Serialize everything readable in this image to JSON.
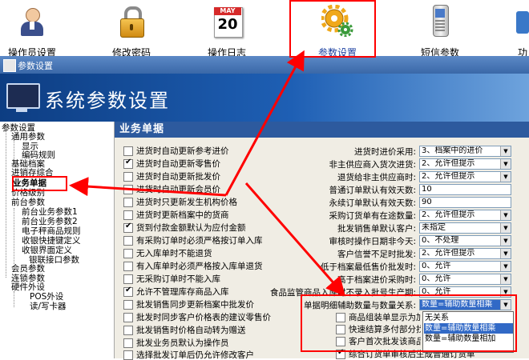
{
  "toolbar": {
    "items": [
      {
        "label": "操作员设置",
        "icon": "operators-icon"
      },
      {
        "label": "修改密码",
        "icon": "lock-icon"
      },
      {
        "label": "操作日志",
        "icon": "calendar-icon"
      },
      {
        "label": "参数设置",
        "icon": "gear-icon"
      },
      {
        "label": "短信参数",
        "icon": "phone-icon"
      },
      {
        "label": "功",
        "icon": "partial-icon"
      }
    ],
    "calendar_month": "MAY",
    "calendar_day": "20"
  },
  "window": {
    "title": "参数设置"
  },
  "banner": {
    "title": "系统参数设置"
  },
  "tree": {
    "nodes": [
      {
        "label": "参数设置"
      },
      {
        "label": "通用参数"
      },
      {
        "label": "显示"
      },
      {
        "label": "编码规则"
      },
      {
        "label": "基础档案"
      },
      {
        "label": "进销存综合"
      },
      {
        "label": "业务单据"
      },
      {
        "label": "价格级别"
      },
      {
        "label": "前台参数"
      },
      {
        "label": "前台业务参数1"
      },
      {
        "label": "前台业务参数2"
      },
      {
        "label": "电子秤商品规则"
      },
      {
        "label": "收银快捷键定义"
      },
      {
        "label": "收银界面定义"
      },
      {
        "label": "银联接口参数"
      },
      {
        "label": "会员参数"
      },
      {
        "label": "连锁参数"
      },
      {
        "label": "硬件外设"
      },
      {
        "label": "POS外设"
      },
      {
        "label": "读/写卡器"
      }
    ]
  },
  "panel": {
    "title": "业务单据",
    "left_checks": [
      {
        "label": "进货时自动更新参考进价",
        "checked": false
      },
      {
        "label": "进货时自动更新零售价",
        "checked": true
      },
      {
        "label": "进货时自动更新批发价",
        "checked": false
      },
      {
        "label": "进货时自动更新会员价",
        "checked": false
      },
      {
        "label": "进货时只更新发生机构价格",
        "checked": false
      },
      {
        "label": "进货时更新档案中的货商",
        "checked": false
      },
      {
        "label": "货到付款金额默认为应付金额",
        "checked": true
      },
      {
        "label": "有采购订单时必须严格按订单入库",
        "checked": false
      },
      {
        "label": "无入库单时不能退货",
        "checked": false
      },
      {
        "label": "有入库单时必须严格按入库单退货",
        "checked": false
      },
      {
        "label": "无采购订单时不能入库",
        "checked": false
      },
      {
        "label": "允许不管理库存商品入库",
        "checked": true
      },
      {
        "label": "批发销售同步更新档案中批发价",
        "checked": false
      },
      {
        "label": "批发时同步客户价格表的建议零售价",
        "checked": false
      },
      {
        "label": "批发销售时价格自动转为赠送",
        "checked": false
      },
      {
        "label": "批发业务员默认为操作员",
        "checked": false
      },
      {
        "label": "选择批发订单后仍允许修改客户",
        "checked": false
      }
    ],
    "right_rows": [
      {
        "label": "进货时进价采用:",
        "value": "3、档案中的进价",
        "type": "select"
      },
      {
        "label": "非主供应商入货次进货:",
        "value": "2、允许但提示",
        "type": "select"
      },
      {
        "label": "退货给非主供应商时:",
        "value": "2、允许但提示",
        "type": "select"
      },
      {
        "label": "普通订单默认有效天数:",
        "value": "10",
        "type": "text"
      },
      {
        "label": "永续订单默认有效天数:",
        "value": "90",
        "type": "text"
      },
      {
        "label": "采购订货单有在途数量:",
        "value": "2、允许但提示",
        "type": "select"
      },
      {
        "label": "批发销售单默认客户:",
        "value": "未指定",
        "type": "select"
      },
      {
        "label": "审核时操作日期非今天:",
        "value": "0、不处理",
        "type": "select"
      },
      {
        "label": "客户信誉不足时批发:",
        "value": "2、允许但提示",
        "type": "select"
      },
      {
        "label": "低于档案最低售价批发时:",
        "value": "0、允许",
        "type": "select"
      },
      {
        "label": "高于档案进价采购时:",
        "value": "0、允许",
        "type": "select"
      },
      {
        "label": "食品监管商品入库时不录入批号生产期:",
        "value": "0、允许",
        "type": "select"
      },
      {
        "label": "单据明细辅助数量与数量关系:",
        "value": "数量=辅助数量相乘",
        "type": "select"
      }
    ],
    "bottom_checks": [
      {
        "label": "商品组装单显示为加工单",
        "checked": false
      },
      {
        "label": "快速结算多付部分找零",
        "checked": false
      },
      {
        "label": "客户首次批发该商品时提示",
        "checked": false
      },
      {
        "label": "综合订货单审核后生成普通订货单",
        "checked": true
      }
    ],
    "dropdown_options": [
      "无关系",
      "数量=辅助数量相乘",
      "数量=辅助数量相加"
    ],
    "dropdown_selected_index": 1
  },
  "colors": {
    "annotation": "#ff0000",
    "selection": "#3169c6",
    "header": "#2d5a9e"
  }
}
